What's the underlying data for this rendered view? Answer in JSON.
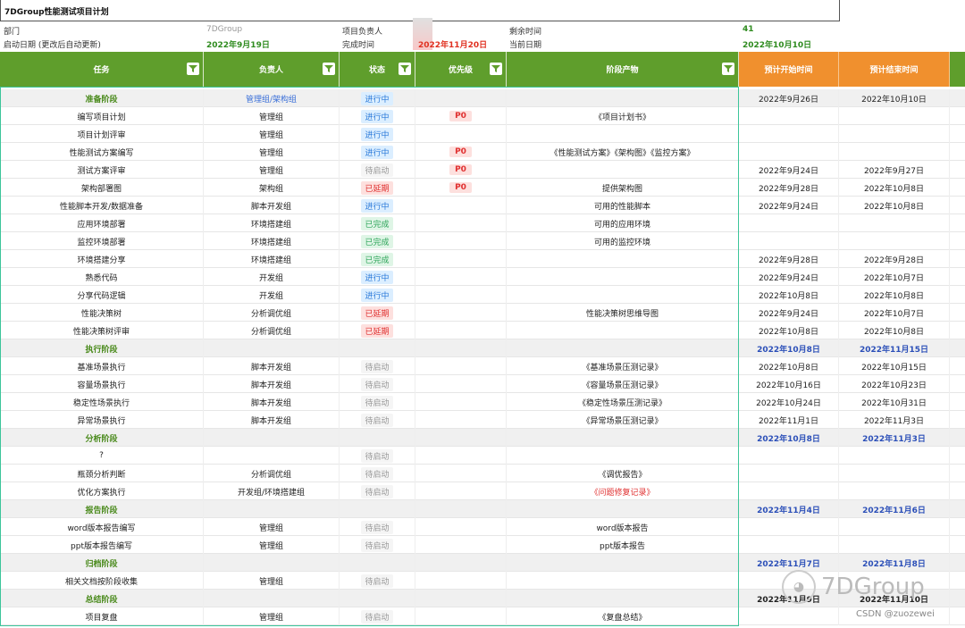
{
  "title": "7DGroup性能测试项目计划",
  "info": {
    "dept_label": "部门",
    "dept_value": "7DGroup",
    "owner_label": "项目负责人",
    "remaining_label": "剩余时间",
    "remaining_value": "41",
    "start_label": "启动日期 (更改后自动更新)",
    "start_value": "2022年9月19日",
    "finish_label": "完成时间",
    "finish_value": "2022年11月20日",
    "today_label": "当前日期",
    "today_value": "2022年10月10日"
  },
  "headers": {
    "task": "任务",
    "owner": "负责人",
    "status": "状态",
    "priority": "优先级",
    "deliverable": "阶段产物",
    "start": "预计开始时间",
    "end": "预计结束时间"
  },
  "rows": [
    {
      "stage": true,
      "task": "准备阶段",
      "owner": "管理组/架构组",
      "status": "进行中",
      "priority": "",
      "deliverable": "",
      "start": "2022年9月26日",
      "end": "2022年10月10日",
      "stage_date_color": false
    },
    {
      "task": "编写项目计划",
      "owner": "管理组",
      "status": "进行中",
      "priority": "P0",
      "deliverable": "《项目计划书》",
      "start": "",
      "end": ""
    },
    {
      "task": "项目计划评审",
      "owner": "管理组",
      "status": "进行中",
      "priority": "",
      "deliverable": "",
      "start": "",
      "end": ""
    },
    {
      "task": "性能测试方案编写",
      "owner": "管理组",
      "status": "进行中",
      "priority": "P0",
      "deliverable": "《性能测试方案》《架构图》《监控方案》",
      "start": "",
      "end": ""
    },
    {
      "task": "测试方案评审",
      "owner": "管理组",
      "status": "待启动",
      "priority": "P0",
      "deliverable": "",
      "start": "2022年9月24日",
      "end": "2022年9月27日"
    },
    {
      "task": "架构部署图",
      "owner": "架构组",
      "status": "已延期",
      "priority": "P0",
      "deliverable": "提供架构图",
      "start": "2022年9月28日",
      "end": "2022年10月8日"
    },
    {
      "task": "性能脚本开发/数据准备",
      "owner": "脚本开发组",
      "status": "进行中",
      "priority": "",
      "deliverable": "可用的性能脚本",
      "start": "2022年9月24日",
      "end": "2022年10月8日"
    },
    {
      "task": "应用环境部署",
      "owner": "环境搭建组",
      "status": "已完成",
      "priority": "",
      "deliverable": "可用的应用环境",
      "start": "",
      "end": ""
    },
    {
      "task": "监控环境部署",
      "owner": "环境搭建组",
      "status": "已完成",
      "priority": "",
      "deliverable": "可用的监控环境",
      "start": "",
      "end": ""
    },
    {
      "task": "环境搭建分享",
      "owner": "环境搭建组",
      "status": "已完成",
      "priority": "",
      "deliverable": "",
      "start": "2022年9月28日",
      "end": "2022年9月28日"
    },
    {
      "task": "熟悉代码",
      "owner": "开发组",
      "status": "进行中",
      "priority": "",
      "deliverable": "",
      "start": "2022年9月24日",
      "end": "2022年10月7日"
    },
    {
      "task": "分享代码逻辑",
      "owner": "开发组",
      "status": "进行中",
      "priority": "",
      "deliverable": "",
      "start": "2022年10月8日",
      "end": "2022年10月8日"
    },
    {
      "task": "性能决策树",
      "owner": "分析调优组",
      "status": "已延期",
      "priority": "",
      "deliverable": "性能决策树思维导图",
      "start": "2022年9月24日",
      "end": "2022年10月7日"
    },
    {
      "task": "性能决策树评审",
      "owner": "分析调优组",
      "status": "已延期",
      "priority": "",
      "deliverable": "",
      "start": "2022年10月8日",
      "end": "2022年10月8日"
    },
    {
      "stage": true,
      "task": "执行阶段",
      "owner": "",
      "status": "",
      "priority": "",
      "deliverable": "",
      "start": "2022年10月8日",
      "end": "2022年11月15日",
      "stage_date_color": true
    },
    {
      "task": "基准场景执行",
      "owner": "脚本开发组",
      "status": "待启动",
      "priority": "",
      "deliverable": "《基准场景压测记录》",
      "start": "2022年10月8日",
      "end": "2022年10月15日"
    },
    {
      "task": "容量场景执行",
      "owner": "脚本开发组",
      "status": "待启动",
      "priority": "",
      "deliverable": "《容量场景压测记录》",
      "start": "2022年10月16日",
      "end": "2022年10月23日"
    },
    {
      "task": "稳定性场景执行",
      "owner": "脚本开发组",
      "status": "待启动",
      "priority": "",
      "deliverable": "《稳定性场景压测记录》",
      "start": "2022年10月24日",
      "end": "2022年10月31日"
    },
    {
      "task": "异常场景执行",
      "owner": "脚本开发组",
      "status": "待启动",
      "priority": "",
      "deliverable": "《异常场景压测记录》",
      "start": "2022年11月1日",
      "end": "2022年11月3日"
    },
    {
      "stage": true,
      "task": "分析阶段",
      "owner": "",
      "status": "",
      "priority": "",
      "deliverable": "",
      "start": "2022年10月8日",
      "end": "2022年11月3日",
      "stage_date_color": true
    },
    {
      "task": "?",
      "owner": "",
      "status": "待启动",
      "priority": "",
      "deliverable": "",
      "start": "",
      "end": ""
    },
    {
      "task": "瓶颈分析判断",
      "owner": "分析调优组",
      "status": "待启动",
      "priority": "",
      "deliverable": "《调优报告》",
      "start": "",
      "end": ""
    },
    {
      "task": "优化方案执行",
      "owner": "开发组/环境搭建组",
      "status": "待启动",
      "priority": "",
      "deliverable": "《问题修复记录》",
      "deliverable_red": true,
      "start": "",
      "end": ""
    },
    {
      "stage": true,
      "task": "报告阶段",
      "owner": "",
      "status": "",
      "priority": "",
      "deliverable": "",
      "start": "2022年11月4日",
      "end": "2022年11月6日",
      "stage_date_color": true
    },
    {
      "task": "word版本报告编写",
      "owner": "管理组",
      "status": "待启动",
      "priority": "",
      "deliverable": "word版本报告",
      "start": "",
      "end": ""
    },
    {
      "task": "ppt版本报告编写",
      "owner": "管理组",
      "status": "待启动",
      "priority": "",
      "deliverable": "ppt版本报告",
      "start": "",
      "end": ""
    },
    {
      "stage": true,
      "task": "归档阶段",
      "owner": "",
      "status": "",
      "priority": "",
      "deliverable": "",
      "start": "2022年11月7日",
      "end": "2022年11月8日",
      "stage_date_color": true
    },
    {
      "task": "相关文档按阶段收集",
      "owner": "管理组",
      "status": "待启动",
      "priority": "",
      "deliverable": "",
      "start": "",
      "end": ""
    },
    {
      "stage": true,
      "task": "总结阶段",
      "owner": "",
      "status": "",
      "priority": "",
      "deliverable": "",
      "start": "2022年11月9日",
      "end": "2022年11月10日",
      "stage_date_color": false,
      "stage_dark": true
    },
    {
      "task": "项目复盘",
      "owner": "管理组",
      "status": "待启动",
      "priority": "",
      "deliverable": "《复盘总结》",
      "start": "",
      "end": ""
    }
  ],
  "watermark": "7DGroup",
  "credit": "CSDN @zuozewei",
  "colors": {
    "header_green": "#5f9e2c",
    "header_orange": "#f0902e",
    "stage_green": "#4a8a1c",
    "stage_date_blue": "#2b4fb8"
  }
}
